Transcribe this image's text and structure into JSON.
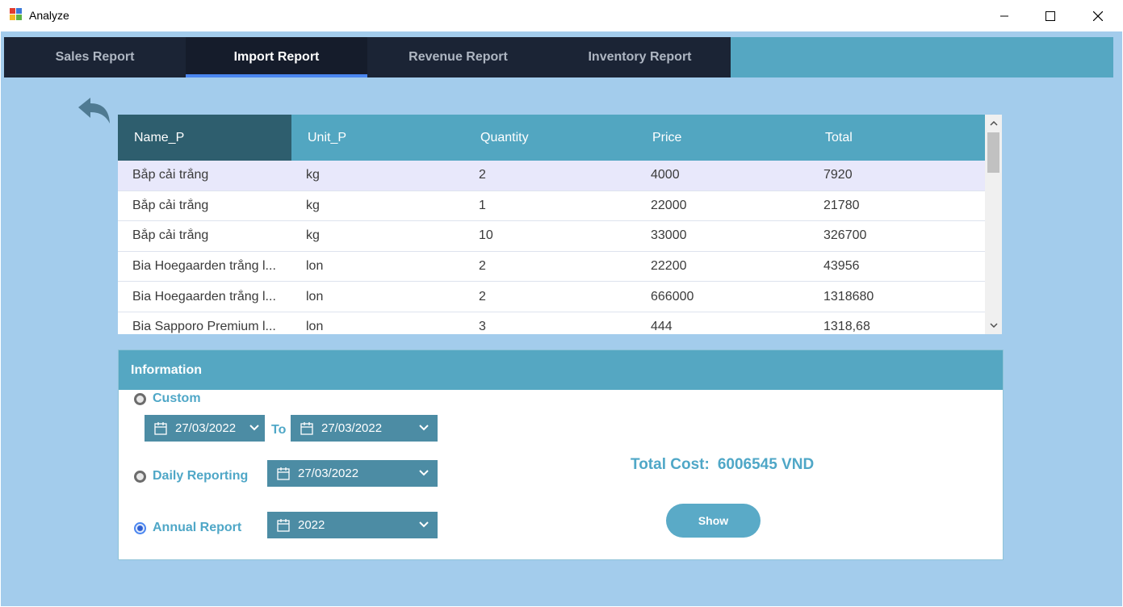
{
  "window": {
    "title": "Analyze",
    "icon": "windows-forms-app-icon",
    "controls": [
      "minimize-icon",
      "maximize-icon",
      "close-icon"
    ]
  },
  "tabs": [
    {
      "label": "Sales Report",
      "active": false
    },
    {
      "label": "Import Report",
      "active": true
    },
    {
      "label": "Revenue Report",
      "active": false
    },
    {
      "label": "Inventory Report",
      "active": false
    }
  ],
  "back_button": {
    "icon": "back-arrow-icon"
  },
  "grid": {
    "columns": [
      "Name_P",
      "Unit_P",
      "Quantity",
      "Price",
      "Total"
    ],
    "rows": [
      [
        "Bắp cải trắng",
        "kg",
        "2",
        "4000",
        "7920"
      ],
      [
        "Bắp cải trắng",
        "kg",
        "1",
        "22000",
        "21780"
      ],
      [
        "Bắp cải trắng",
        "kg",
        "10",
        "33000",
        "326700"
      ],
      [
        "Bia Hoegaarden trắng l...",
        "lon",
        "2",
        "22200",
        "43956"
      ],
      [
        "Bia Hoegaarden trắng l...",
        "lon",
        "2",
        "666000",
        "1318680"
      ],
      [
        "Bia Sapporo Premium l...",
        "lon",
        "3",
        "444",
        "1318,68"
      ]
    ],
    "selected_row": 0
  },
  "info": {
    "header": "Information",
    "custom": {
      "label": "Custom",
      "checked": false,
      "from": "27/03/2022",
      "to_label": "To",
      "to": "27/03/2022"
    },
    "daily": {
      "label": "Daily Reporting",
      "checked": false,
      "date": "27/03/2022"
    },
    "annual": {
      "label": "Annual Report",
      "checked": true,
      "year": "2022"
    },
    "total_label": "Total Cost:",
    "total_value": "6006545 VND",
    "show_label": "Show"
  },
  "colors": {
    "background": "#a3ccec",
    "tab_dark": "#1b2435",
    "tab_active_indicator": "#4a86f0",
    "accent": "#55a7c2",
    "picker": "#4c8ca4",
    "header_first_col": "#2e5e6e"
  }
}
